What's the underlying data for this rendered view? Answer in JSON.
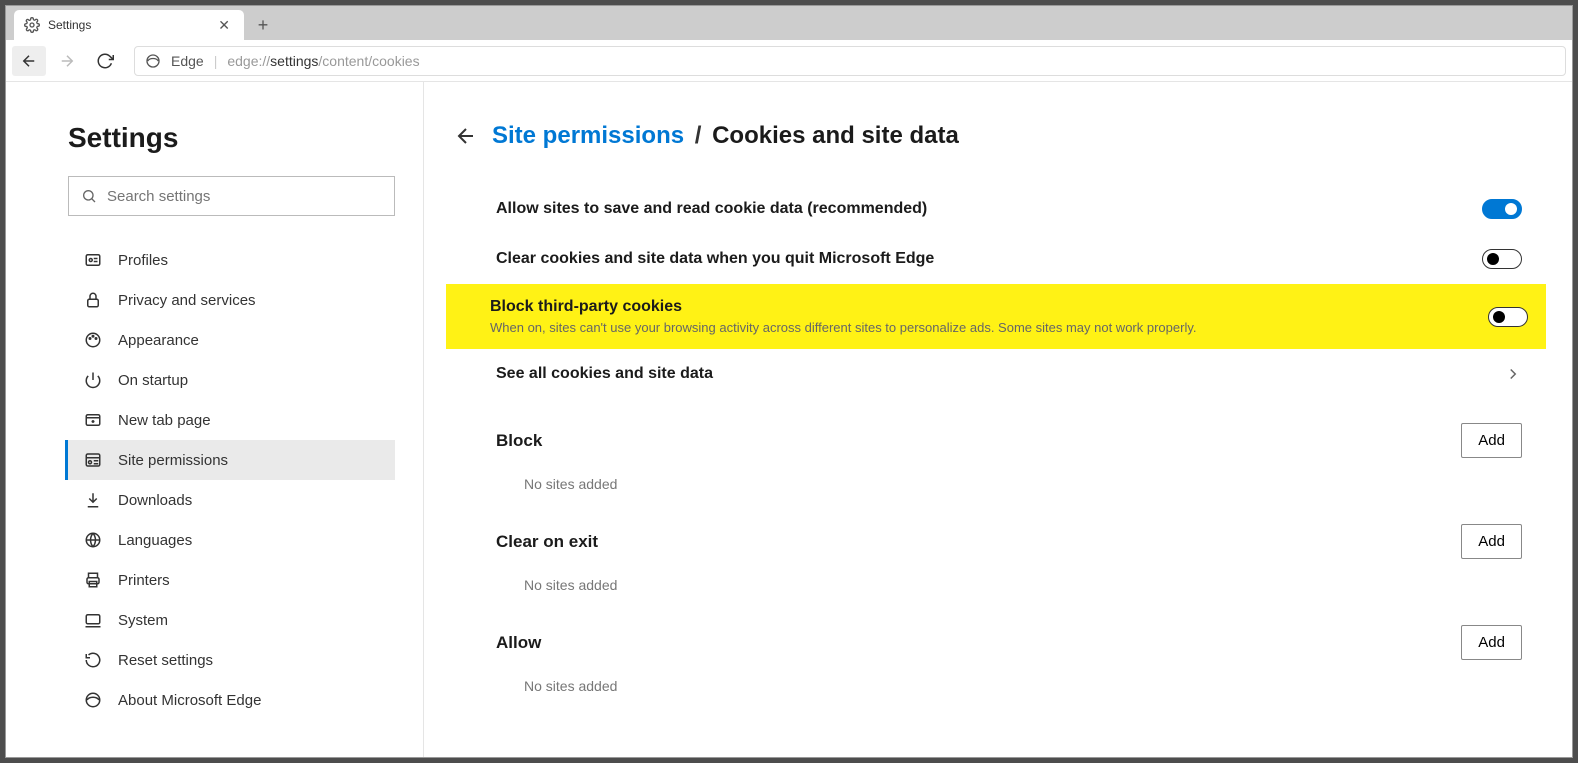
{
  "tab": {
    "title": "Settings"
  },
  "url": {
    "edge_label": "Edge",
    "prefix": "edge://",
    "dark": "settings",
    "rest": "/content/cookies"
  },
  "sidebar": {
    "heading": "Settings",
    "search_placeholder": "Search settings",
    "items": [
      {
        "label": "Profiles"
      },
      {
        "label": "Privacy and services"
      },
      {
        "label": "Appearance"
      },
      {
        "label": "On startup"
      },
      {
        "label": "New tab page"
      },
      {
        "label": "Site permissions"
      },
      {
        "label": "Downloads"
      },
      {
        "label": "Languages"
      },
      {
        "label": "Printers"
      },
      {
        "label": "System"
      },
      {
        "label": "Reset settings"
      },
      {
        "label": "About Microsoft Edge"
      }
    ]
  },
  "crumb": {
    "parent": "Site permissions",
    "sep": "/",
    "current": "Cookies and site data"
  },
  "rows": {
    "allow": {
      "title": "Allow sites to save and read cookie data (recommended)"
    },
    "clear": {
      "title": "Clear cookies and site data when you quit Microsoft Edge"
    },
    "block3": {
      "title": "Block third-party cookies",
      "desc": "When on, sites can't use your browsing activity across different sites to personalize ads. Some sites may not work properly."
    },
    "seeall": {
      "title": "See all cookies and site data"
    }
  },
  "sections": {
    "block": {
      "title": "Block",
      "add": "Add",
      "empty": "No sites added"
    },
    "clearexit": {
      "title": "Clear on exit",
      "add": "Add",
      "empty": "No sites added"
    },
    "allow": {
      "title": "Allow",
      "add": "Add",
      "empty": "No sites added"
    }
  }
}
